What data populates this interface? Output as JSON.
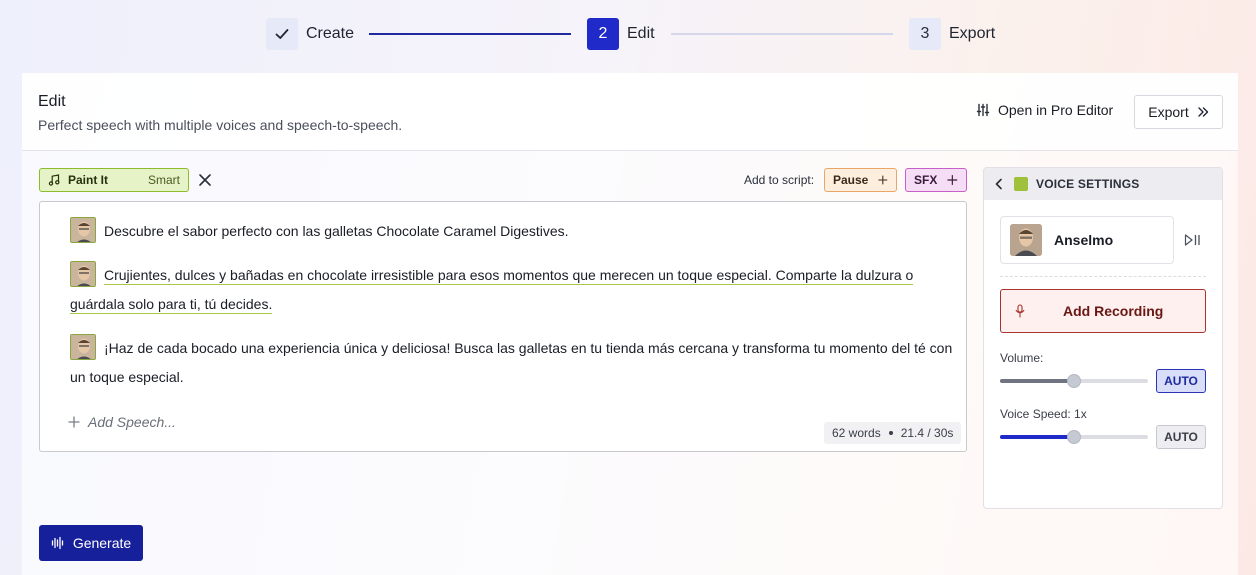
{
  "stepper": {
    "steps": [
      {
        "index": "",
        "label": "Create",
        "state": "done"
      },
      {
        "index": "2",
        "label": "Edit",
        "state": "active"
      },
      {
        "index": "3",
        "label": "Export",
        "state": "pending"
      }
    ]
  },
  "header": {
    "title": "Edit",
    "subtitle": "Perfect speech with multiple voices and speech-to-speech.",
    "pro_editor_label": "Open in Pro Editor",
    "export_label": "Export"
  },
  "toolbar": {
    "music_tag": {
      "name": "Paint It",
      "mode": "Smart"
    },
    "add_to_script_label": "Add to script:",
    "pause_label": "Pause",
    "sfx_label": "SFX"
  },
  "script": {
    "paragraphs": [
      "Descubre el sabor perfecto con las galletas Chocolate Caramel Digestives.",
      "Crujientes, dulces y bañadas en chocolate irresistible para esos momentos que merecen un toque especial. Comparte la dulzura o guárdala solo para ti, tú decides.",
      "¡Haz de cada bocado una experiencia única y deliciosa! Busca las galletas en tu tienda más cercana y transforma tu momento del té con un toque especial."
    ],
    "add_speech_label": "Add Speech...",
    "word_count": "62 words",
    "duration": "21.4 / 30s"
  },
  "generate_label": "Generate",
  "voice_settings": {
    "title": "VOICE SETTINGS",
    "voice_name": "Anselmo",
    "add_recording_label": "Add Recording",
    "volume_label": "Volume:",
    "volume_value": 0.5,
    "volume_auto_label": "AUTO",
    "volume_auto_on": true,
    "speed_label": "Voice Speed: 1x",
    "speed_value": 0.5,
    "speed_auto_label": "AUTO",
    "speed_auto_on": false
  },
  "colors": {
    "accent": "#1f2ac8",
    "generate": "#17209b",
    "music_tag": "#8dbb2d",
    "pause": "#e7a867",
    "sfx": "#c75fc9",
    "recording": "#a8342f"
  }
}
